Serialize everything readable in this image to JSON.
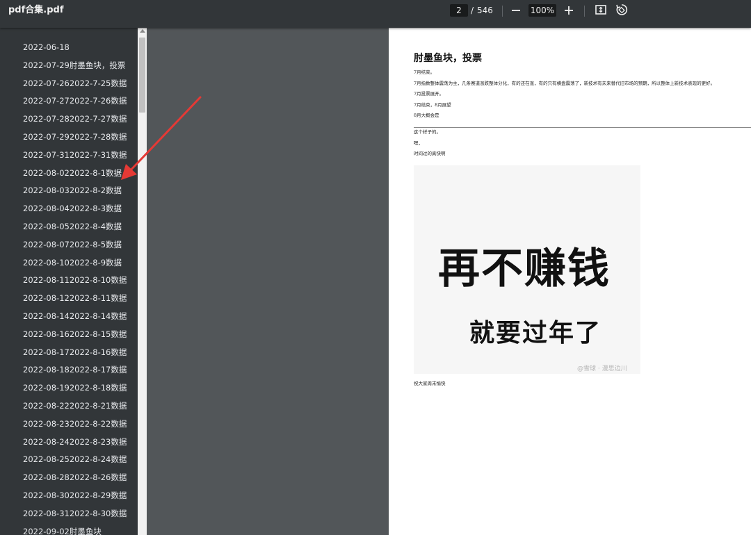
{
  "toolbar": {
    "title": "pdf合集.pdf",
    "page_current": "2",
    "page_separator": "/",
    "page_total": "546",
    "zoom": "100%",
    "icons": [
      "zoom-out-icon",
      "zoom-in-icon",
      "fit-page-icon",
      "rotate-icon"
    ]
  },
  "sidebar": {
    "items": [
      {
        "label": "2022-06-18"
      },
      {
        "label": "2022-07-29肘墨鱼块，投票"
      },
      {
        "label": "2022-07-262022-7-25数据"
      },
      {
        "label": "2022-07-272022-7-26数据"
      },
      {
        "label": "2022-07-282022-7-27数据"
      },
      {
        "label": "2022-07-292022-7-28数据"
      },
      {
        "label": "2022-07-312022-7-31数据"
      },
      {
        "label": "2022-08-022022-8-1数据"
      },
      {
        "label": "2022-08-032022-8-2数据"
      },
      {
        "label": "2022-08-042022-8-3数据"
      },
      {
        "label": "2022-08-052022-8-4数据"
      },
      {
        "label": "2022-08-072022-8-5数据"
      },
      {
        "label": "2022-08-102022-8-9数据"
      },
      {
        "label": "2022-08-112022-8-10数据"
      },
      {
        "label": "2022-08-122022-8-11数据"
      },
      {
        "label": "2022-08-142022-8-14数据"
      },
      {
        "label": "2022-08-162022-8-15数据"
      },
      {
        "label": "2022-08-172022-8-16数据"
      },
      {
        "label": "2022-08-182022-8-17数据"
      },
      {
        "label": "2022-08-192022-8-18数据"
      },
      {
        "label": "2022-08-222022-8-21数据"
      },
      {
        "label": "2022-08-232022-8-22数据"
      },
      {
        "label": "2022-08-242022-8-23数据"
      },
      {
        "label": "2022-08-252022-8-24数据"
      },
      {
        "label": "2022-08-282022-8-26数据"
      },
      {
        "label": "2022-08-302022-8-29数据"
      },
      {
        "label": "2022-08-312022-8-30数据"
      },
      {
        "label": "2022-09-02肘墨鱼块"
      }
    ]
  },
  "page": {
    "title": "肘墨鱼块，投票",
    "lines": [
      "7月结束。",
      "7月指数整体震荡为主，几条赛道涨跌整体分化，有的还在涨，有的只有横盘震荡了，新技术有未来替代旧市场的预期，所以整体上新技术表现的更好。",
      "7月投票展开。",
      "7月结束，8月展望",
      "8月大概会是",
      "这个样子的。",
      "嗯，",
      "时间过的真快啊"
    ],
    "meme_big": "再不赚钱",
    "meme_small": "就要过年了",
    "meme_watermark": "@雪球 · 漫思边川",
    "footer": "祝大家周末愉快"
  },
  "colors": {
    "toolbar_bg": "#323639",
    "sidebar_bg": "#323639",
    "viewer_bg": "#525659",
    "arrow": "#e53935"
  }
}
